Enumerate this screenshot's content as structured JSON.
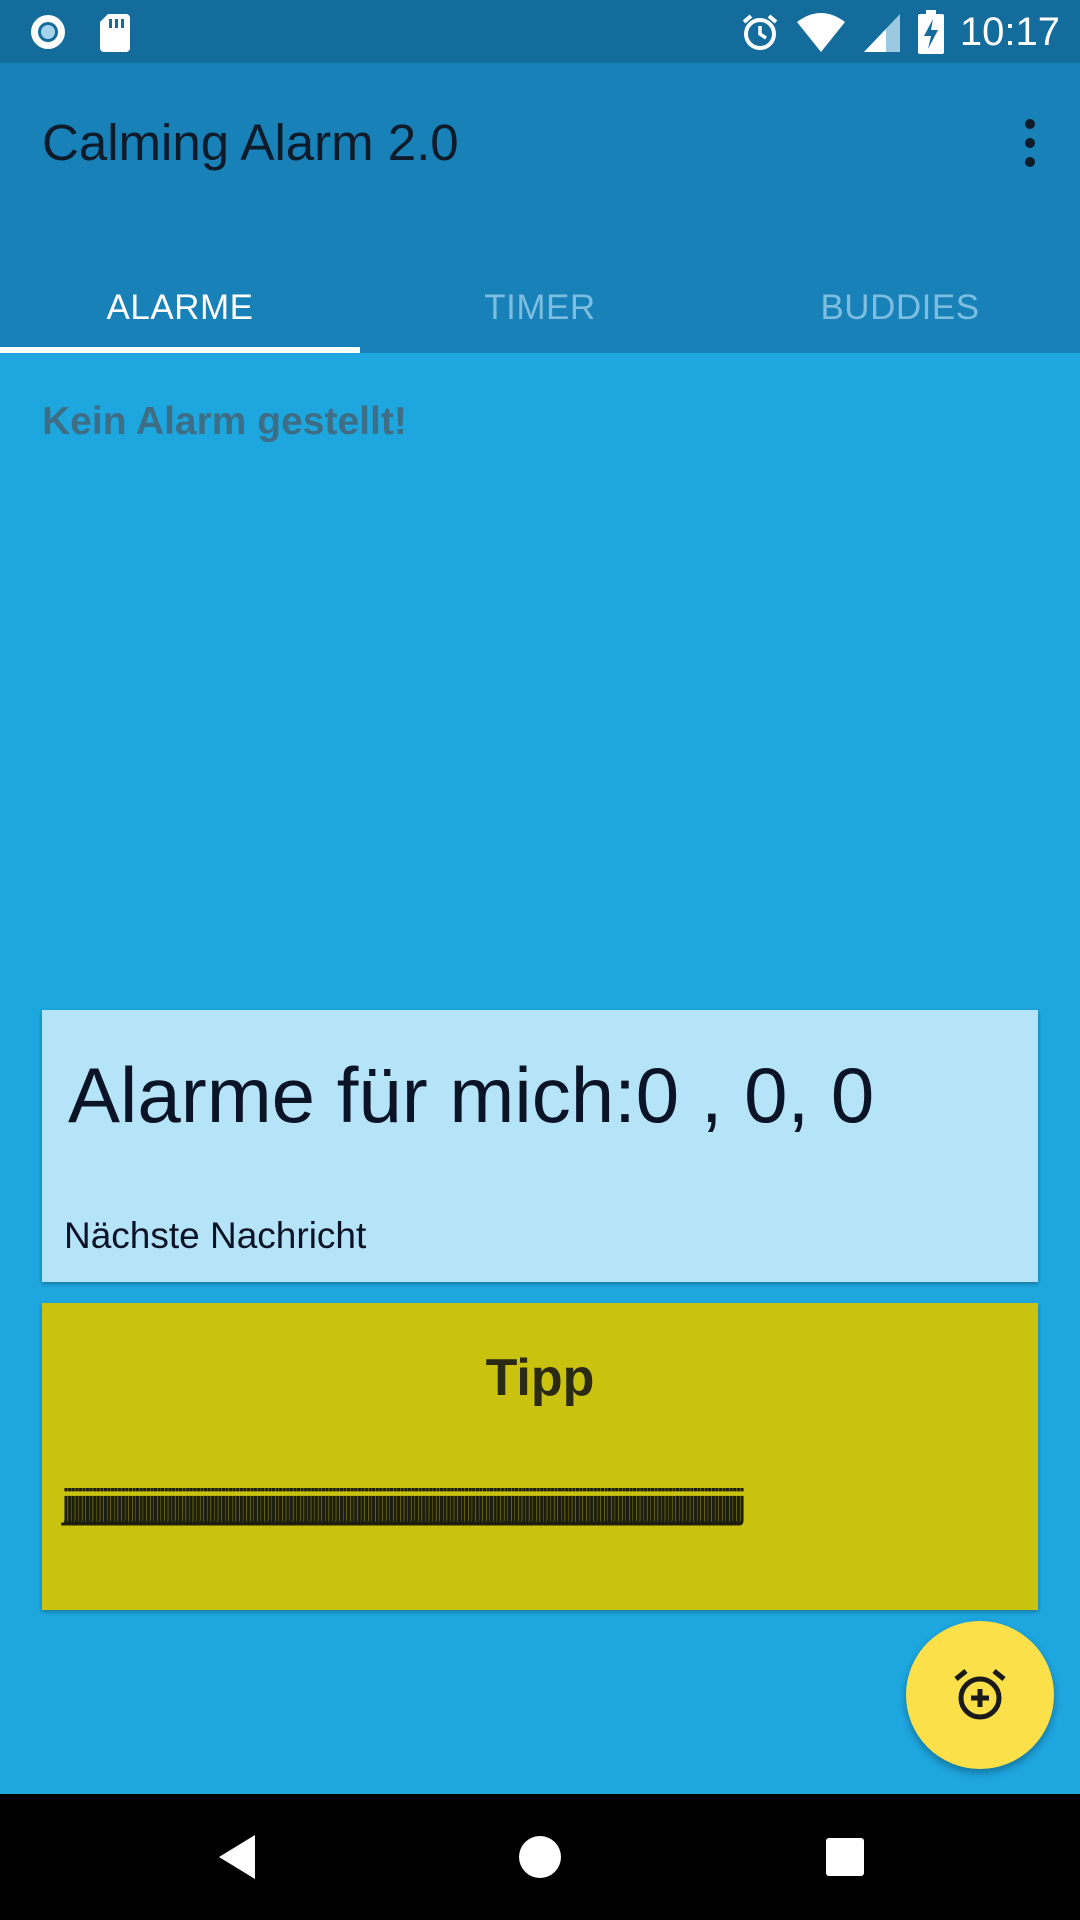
{
  "status_bar": {
    "time": "10:17",
    "icons": [
      "radio-icon",
      "sd-card-icon",
      "alarm-clock-icon",
      "wifi-icon",
      "cell-signal-icon",
      "battery-charging-icon"
    ]
  },
  "app_bar": {
    "title": "Calming Alarm 2.0",
    "overflow_icon": "more-vert-icon"
  },
  "tabs": [
    {
      "label": "ALARME",
      "active": true
    },
    {
      "label": "TIMER",
      "active": false
    },
    {
      "label": "BUDDIES",
      "active": false
    }
  ],
  "content": {
    "empty_message": "Kein Alarm gestellt!",
    "alarm_card": {
      "headline": "Alarme für mich:0 , 0, 0",
      "subtext": "Nächste Nachricht"
    },
    "tip_card": {
      "title": "Tipp",
      "body": "jjjjjjjjjjjjjjjjjjjjjjjjjjjjjjjjjjjjjjjjjjjjjjjjjjjjjjjjjjjjjjjjjjjjjjjjjjjjjjjjjjjjjjjjjjjjjjjjjjjjjjjjjjjjjjjjjjjjjjjjjjjjjjjjjjjjjjjjjjjjjjjjjjjjjjjjjjjjjjjjjjjjjjjjjjjjjjjjjjjjjjjjjjjjjj"
    },
    "fab_icon": "add-alarm-icon"
  },
  "nav_bar": {
    "icons": [
      "back-icon",
      "home-icon",
      "recents-icon"
    ]
  },
  "colors": {
    "status_bar": "#136c9b",
    "app_bar": "#1781b8",
    "background": "#1ea6df",
    "alarm_card": "#b5e3f8",
    "tip_card": "#c9c20e",
    "fab": "#fbe04a"
  }
}
